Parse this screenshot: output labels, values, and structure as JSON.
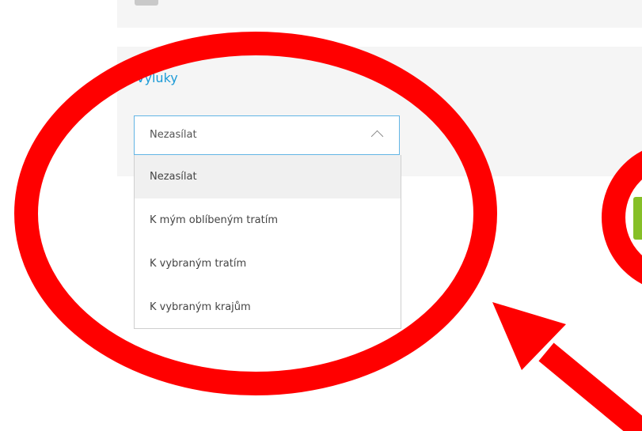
{
  "section": {
    "title": "Výluky"
  },
  "select": {
    "value": "Nezasílat",
    "options": [
      {
        "label": "Nezasílat",
        "selected": true
      },
      {
        "label": "K mým oblíbeným tratím",
        "selected": false
      },
      {
        "label": "K vybraným tratím",
        "selected": false
      },
      {
        "label": "K vybraným krajům",
        "selected": false
      }
    ]
  },
  "colors": {
    "accent": "#1e9bd7",
    "select_border": "#62b5e5",
    "annotation": "#ff0000",
    "button": "#86bf27"
  }
}
